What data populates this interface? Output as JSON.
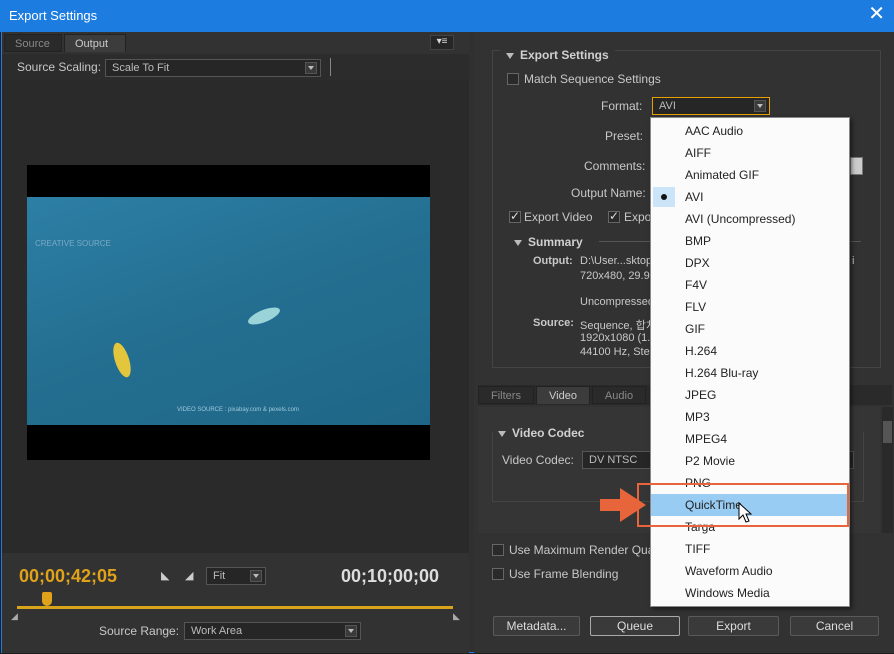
{
  "window": {
    "title": "Export Settings",
    "close_glyph": "✕"
  },
  "left": {
    "tabs": [
      "Source",
      "Output"
    ],
    "active_tab": "Output",
    "source_scaling_label": "Source Scaling:",
    "source_scaling_value": "Scale To Fit",
    "video_watermark": "CREATIVE SOURCE",
    "video_source_text": "VIDEO SOURCE : pixabay.com & pexels.com",
    "timecode_current": "00;00;42;05",
    "timecode_duration": "00;10;00;00",
    "zoom_value": "Fit",
    "source_range_label": "Source Range:",
    "source_range_value": "Work Area"
  },
  "right": {
    "section_title": "Export Settings",
    "match_sequence_label": "Match Sequence Settings",
    "format_label": "Format:",
    "format_value": "AVI",
    "preset_label": "Preset:",
    "comments_label": "Comments:",
    "output_name_label": "Output Name:",
    "export_video_label": "Export Video",
    "export_audio_label": "Expor",
    "summary_title": "Summary",
    "output_label": "Output:",
    "output_lines": [
      "D:\\User...sktop",
      "720x480, 29.97",
      "Uncompressed"
    ],
    "output_tail": "i",
    "source_label": "Source:",
    "source_lines": [
      "Sequence, 합치",
      "1920x1080 (1.0",
      "44100 Hz, Ster"
    ],
    "tabs": [
      "Filters",
      "Video",
      "Audio"
    ],
    "active_tab": "Video",
    "video_codec_title": "Video Codec",
    "video_codec_label": "Video Codec:",
    "video_codec_value": "DV NTSC",
    "max_render_label": "Use Maximum Render Quality",
    "frame_blending_label": "Use Frame Blending",
    "buttons": {
      "metadata": "Metadata...",
      "queue": "Queue",
      "export": "Export",
      "cancel": "Cancel"
    }
  },
  "format_menu": {
    "items": [
      "AAC Audio",
      "AIFF",
      "Animated GIF",
      "AVI",
      "AVI (Uncompressed)",
      "BMP",
      "DPX",
      "F4V",
      "FLV",
      "GIF",
      "H.264",
      "H.264 Blu-ray",
      "JPEG",
      "MP3",
      "MPEG4",
      "P2 Movie",
      "PNG",
      "QuickTime",
      "Targa",
      "TIFF",
      "Waveform Audio",
      "Windows Media"
    ],
    "selected": "AVI",
    "highlighted": "QuickTime"
  },
  "colors": {
    "accent": "#1c7ce0",
    "timecode": "#e0a21a",
    "callout": "#e8643a",
    "highlight": "#99ccf3"
  }
}
